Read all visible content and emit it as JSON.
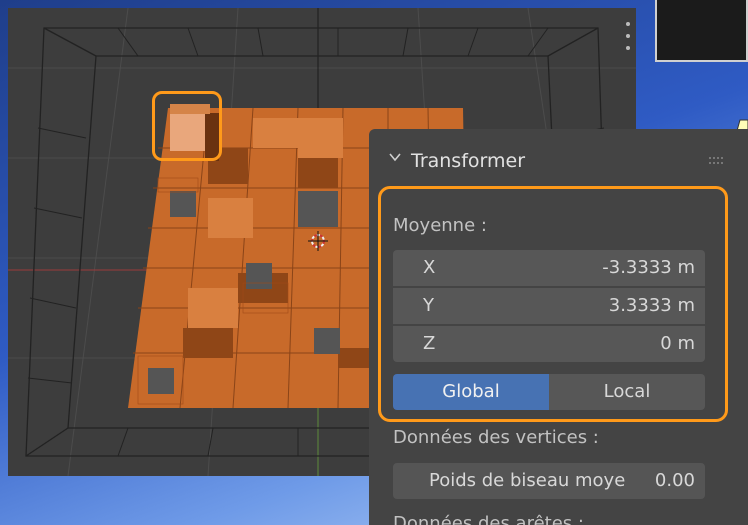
{
  "panel": {
    "title": "Transformer",
    "median_label": "Moyenne :",
    "fields": [
      {
        "axis": "X",
        "value": "-3.3333 m"
      },
      {
        "axis": "Y",
        "value": "3.3333 m"
      },
      {
        "axis": "Z",
        "value": "0 m"
      }
    ],
    "orientation": {
      "global_label": "Global",
      "local_label": "Local",
      "selected": "Global"
    },
    "vertex_data_label": "Données des vertices :",
    "bevel_weight": {
      "label": "Poids de biseau moye",
      "value": "0.00"
    },
    "edge_data_label": "Données des arêtes :"
  },
  "icons": {
    "collapse": "chevron-down-icon",
    "grip": "drag-grip-icon",
    "cursor": "3d-cursor-icon"
  },
  "colors": {
    "accent_orange": "#ff9a1a",
    "selected_blue": "#4772b3",
    "tile_orange": "#c86a2a"
  }
}
